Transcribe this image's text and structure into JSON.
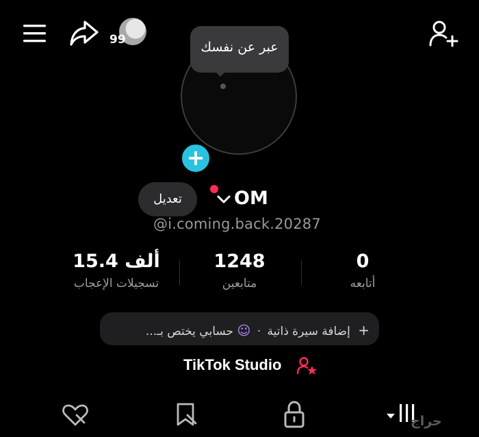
{
  "header": {
    "story_count": "99"
  },
  "profile": {
    "bio_prompt": "عبر عن نفسك",
    "display_name": "OM",
    "username": "@i.coming.back.20287",
    "edit_label": "تعديل"
  },
  "stats": [
    {
      "value": "0",
      "label": "أتابعه"
    },
    {
      "value": "1248",
      "label": "متابعين"
    },
    {
      "value": "15.4 ألف",
      "label": "تسجيلات الإعجاب"
    }
  ],
  "bio_bar": {
    "add_bio": "إضافة سيرة ذاتية",
    "separator": "·",
    "account_for": "حسابي يختص بـ...",
    "emoji": "☺"
  },
  "studio": {
    "label": "TikTok Studio"
  },
  "watermark": "حراج",
  "colors": {
    "accent_cyan": "#29c2e0",
    "accent_red": "#fe2c55",
    "background": "#000000"
  },
  "icons": {
    "menu": "hamburger-menu-icon",
    "share": "share-arrow-icon",
    "add_friend": "add-person-icon",
    "add_photo": "plus-icon",
    "tab_videos": "grid-icon",
    "tab_private": "lock-icon",
    "tab_favorites": "bookmark-icon",
    "tab_liked": "heart-icon"
  }
}
